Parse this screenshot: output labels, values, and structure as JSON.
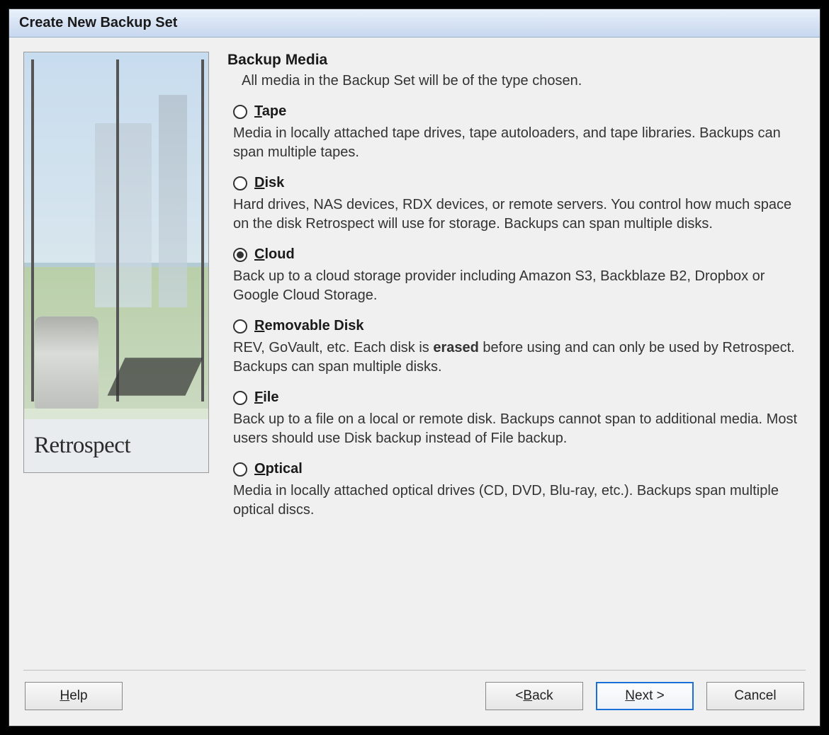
{
  "window": {
    "title": "Create New Backup Set"
  },
  "brand": "Retrospect",
  "section": {
    "title": "Backup Media",
    "subtitle": "All media in the Backup Set will be of the type chosen."
  },
  "options": [
    {
      "id": "tape",
      "mnemonic": "T",
      "rest": "ape",
      "selected": false,
      "desc": "Media in locally attached tape drives, tape autoloaders, and tape libraries. Backups can span multiple tapes."
    },
    {
      "id": "disk",
      "mnemonic": "D",
      "rest": "isk",
      "selected": false,
      "desc": "Hard drives, NAS devices, RDX devices, or remote servers. You control how much space on the disk Retrospect will use for storage. Backups can span multiple disks."
    },
    {
      "id": "cloud",
      "mnemonic": "C",
      "rest": "loud",
      "selected": true,
      "desc": "Back up to a cloud storage provider including Amazon S3, Backblaze B2, Dropbox or Google Cloud Storage."
    },
    {
      "id": "removable",
      "mnemonic": "R",
      "rest": "emovable Disk",
      "selected": false,
      "desc_pre": "REV, GoVault, etc. Each disk is ",
      "desc_bold": "erased",
      "desc_post": " before using and can only be used by Retrospect. Backups can span multiple disks."
    },
    {
      "id": "file",
      "mnemonic": "F",
      "rest": "ile",
      "selected": false,
      "desc": "Back up to a file on a local or remote disk. Backups cannot span to additional media. Most users should use Disk backup instead of File backup."
    },
    {
      "id": "optical",
      "mnemonic": "O",
      "rest": "ptical",
      "selected": false,
      "desc": "Media in locally attached optical drives (CD, DVD, Blu-ray, etc.). Backups span multiple optical discs."
    }
  ],
  "buttons": {
    "help_mnemonic": "H",
    "help_rest": "elp",
    "back_prefix": "< ",
    "back_mnemonic": "B",
    "back_rest": "ack",
    "next_mnemonic": "N",
    "next_rest": "ext >",
    "cancel": "Cancel"
  }
}
